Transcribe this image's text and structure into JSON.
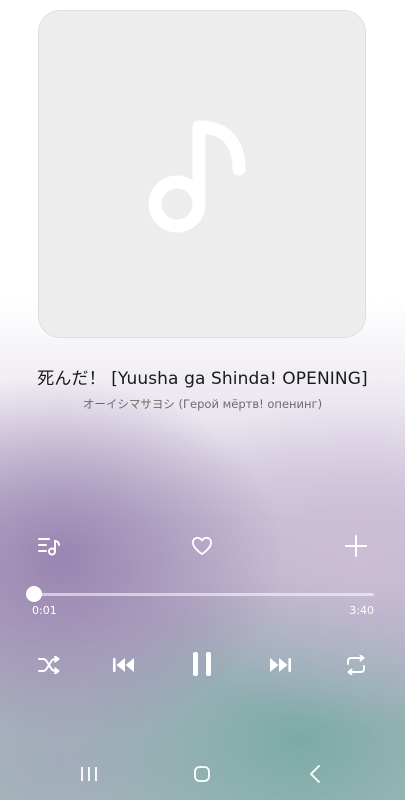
{
  "track": {
    "title": "死んだ！ [Yuusha ga Shinda! OPENING]",
    "artist": "オーイシマサヨシ (Герой мёртв! опенинг)"
  },
  "playback": {
    "elapsed": "0:01",
    "duration": "3:40",
    "progress": 0.005
  },
  "icons": {
    "album_art": "music-note-icon",
    "queue": "playlist-icon",
    "favorite": "heart-icon",
    "add": "plus-icon",
    "shuffle": "shuffle-icon",
    "previous": "skip-previous-icon",
    "play_pause": "pause-icon",
    "next": "skip-next-icon",
    "repeat": "repeat-icon",
    "nav_recents": "recents-icon",
    "nav_home": "home-icon",
    "nav_back": "back-icon"
  },
  "colors": {
    "control_icon": "#ffffff",
    "art_placeholder": "#ededed"
  }
}
